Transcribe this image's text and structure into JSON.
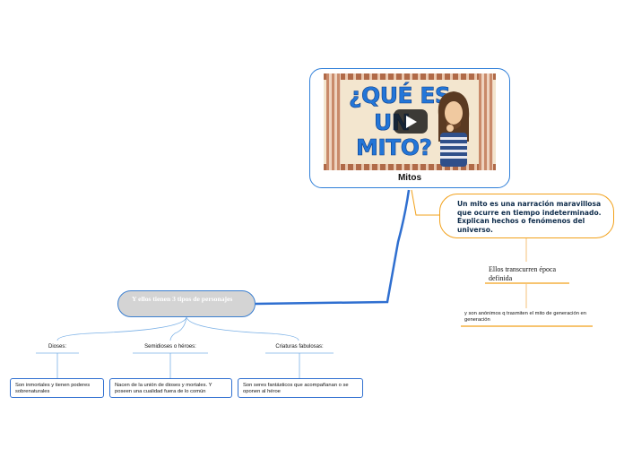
{
  "central": {
    "video_title_lines": [
      "¿QUÉ ES",
      "UN",
      "MITO?"
    ],
    "label": "Mitos"
  },
  "definition": {
    "text": "Un mito es una narración maravillosa que ocurre en tiempo indeterminado. Explican hechos o fenómenos del universo."
  },
  "notes": [
    {
      "text": "Ellos transcurren época definida"
    },
    {
      "text": "y son anónimos q trasmiten el mito de generación en generación"
    }
  ],
  "characters": {
    "label": "Y ellos tienen 3 tipos de personajes",
    "types": [
      {
        "label": "Dioses:",
        "description": "Son inmortales y tienen poderes sobrenaturales"
      },
      {
        "label": "Semidioses o héroes:",
        "description": "Nacen de la unión de dioses y mortales. Y poseen una cualidad fuera de lo común"
      },
      {
        "label": "Criaturas fabulosas:",
        "description": "Son seres fantásticos que acompañanan o se oponen al héroe"
      }
    ]
  },
  "colors": {
    "blue": "#2f6fd0",
    "orange": "#f2a11b",
    "gray_node": "#d4d4d4"
  }
}
